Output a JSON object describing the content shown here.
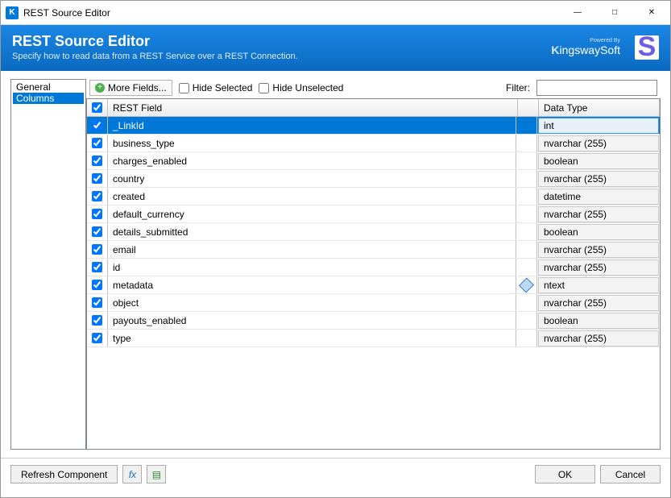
{
  "window": {
    "title": "REST Source Editor",
    "app_icon_letter": "K"
  },
  "header": {
    "title": "REST Source Editor",
    "subtitle": "Specify how to read data from a REST Service over a REST Connection.",
    "powered_by": "Powered By",
    "brand": "KingswaySoft",
    "stripe": "S"
  },
  "sidebar": {
    "items": [
      "General",
      "Columns"
    ],
    "selected_index": 1
  },
  "toolbar": {
    "more_fields": "More Fields...",
    "hide_selected": "Hide Selected",
    "hide_unselected": "Hide Unselected",
    "filter_label": "Filter:",
    "filter_value": ""
  },
  "grid": {
    "header_field": "REST Field",
    "header_type": "Data Type",
    "selected_index": 0,
    "rows": [
      {
        "checked": true,
        "name": "_LinkId",
        "type": "int",
        "icon": false
      },
      {
        "checked": true,
        "name": "business_type",
        "type": "nvarchar (255)",
        "icon": false
      },
      {
        "checked": true,
        "name": "charges_enabled",
        "type": "boolean",
        "icon": false
      },
      {
        "checked": true,
        "name": "country",
        "type": "nvarchar (255)",
        "icon": false
      },
      {
        "checked": true,
        "name": "created",
        "type": "datetime",
        "icon": false
      },
      {
        "checked": true,
        "name": "default_currency",
        "type": "nvarchar (255)",
        "icon": false
      },
      {
        "checked": true,
        "name": "details_submitted",
        "type": "boolean",
        "icon": false
      },
      {
        "checked": true,
        "name": "email",
        "type": "nvarchar (255)",
        "icon": false
      },
      {
        "checked": true,
        "name": "id",
        "type": "nvarchar (255)",
        "icon": false
      },
      {
        "checked": true,
        "name": "metadata",
        "type": "ntext",
        "icon": true
      },
      {
        "checked": true,
        "name": "object",
        "type": "nvarchar (255)",
        "icon": false
      },
      {
        "checked": true,
        "name": "payouts_enabled",
        "type": "boolean",
        "icon": false
      },
      {
        "checked": true,
        "name": "type",
        "type": "nvarchar (255)",
        "icon": false
      }
    ]
  },
  "footer": {
    "refresh": "Refresh Component",
    "fx": "fx",
    "ok": "OK",
    "cancel": "Cancel"
  }
}
